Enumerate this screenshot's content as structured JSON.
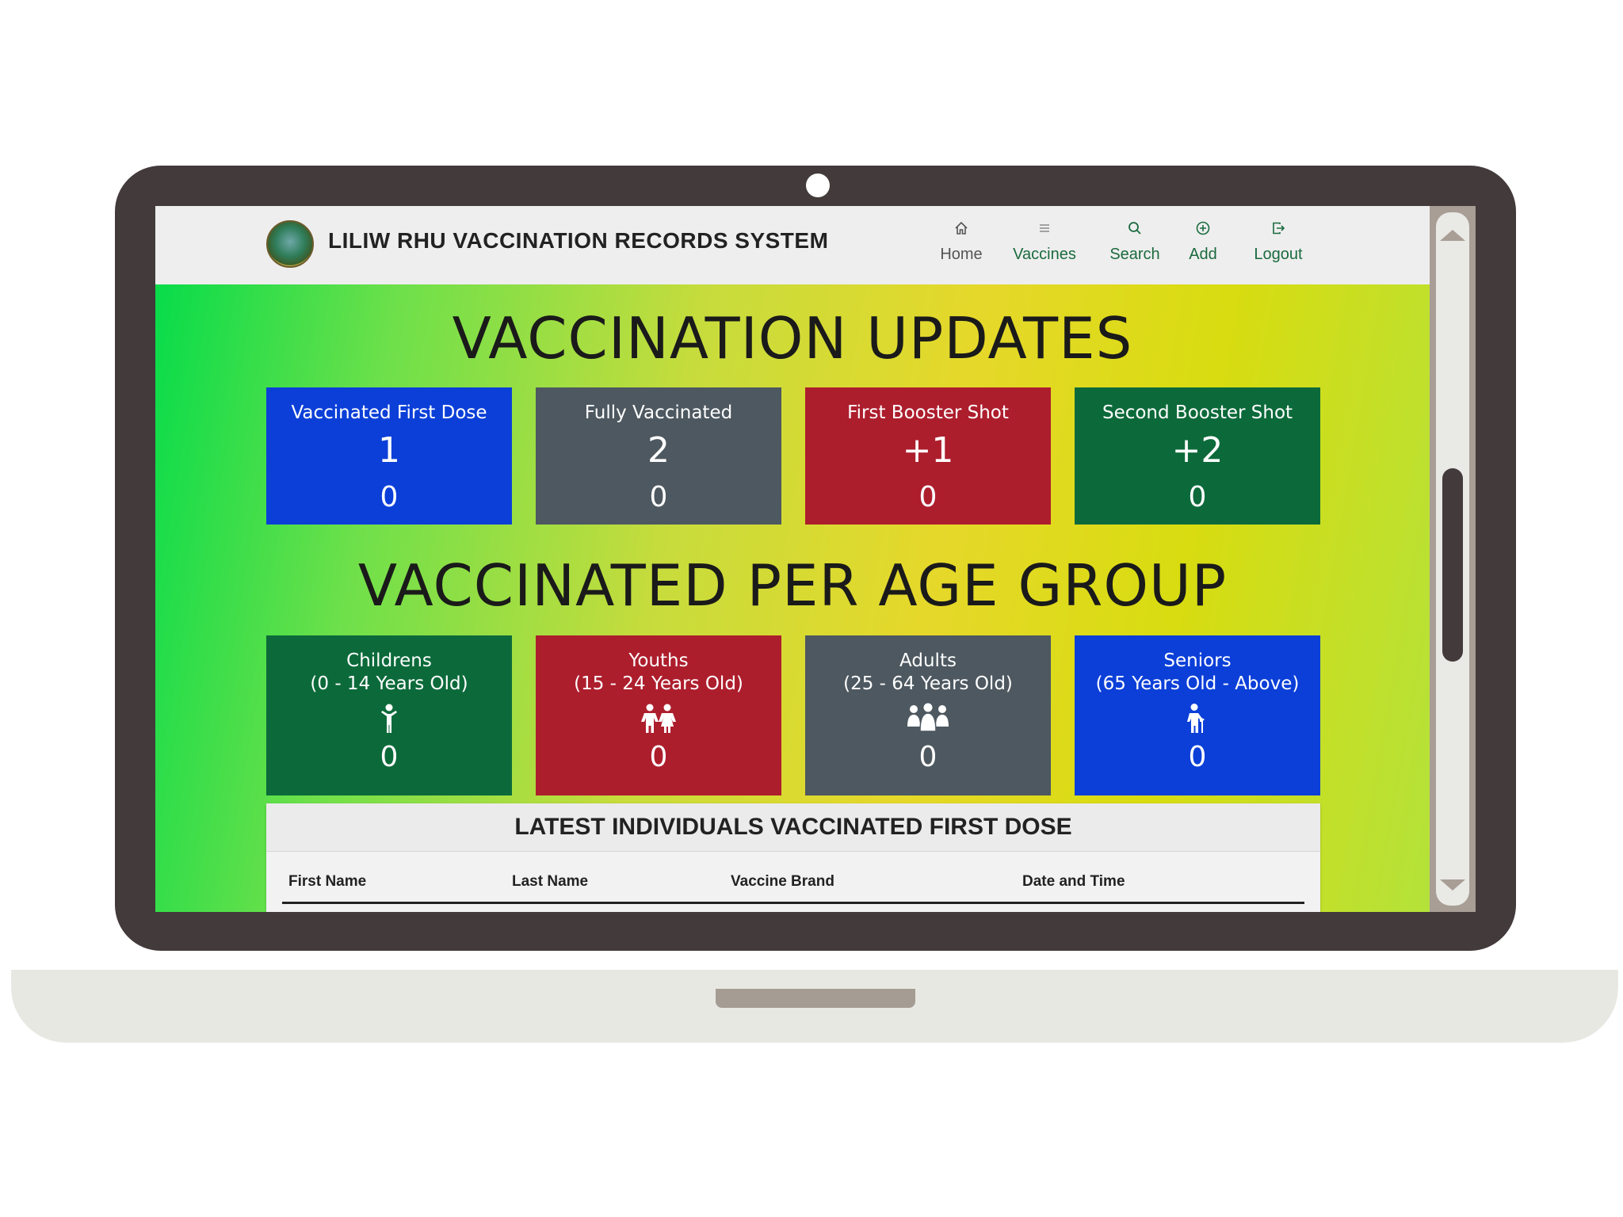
{
  "app": {
    "title": "LILIW RHU VACCINATION RECORDS SYSTEM",
    "logo_icon": "liliw-rhu-seal-icon"
  },
  "nav": {
    "items": [
      {
        "label": "Home",
        "icon": "home-icon"
      },
      {
        "label": "Vaccines",
        "icon": "list-icon"
      },
      {
        "label": "Search",
        "icon": "search-icon"
      },
      {
        "label": "Add",
        "icon": "plus-circle-icon"
      },
      {
        "label": "Logout",
        "icon": "logout-icon"
      }
    ]
  },
  "updates": {
    "heading": "VACCINATION UPDATES",
    "cards": [
      {
        "label": "Vaccinated First Dose",
        "dose": "1",
        "count": "0",
        "color": "#0b3fd8"
      },
      {
        "label": "Fully Vaccinated",
        "dose": "2",
        "count": "0",
        "color": "#4d5860"
      },
      {
        "label": "First Booster Shot",
        "dose": "+1",
        "count": "0",
        "color": "#ad1e2d"
      },
      {
        "label": "Second Booster Shot",
        "dose": "+2",
        "count": "0",
        "color": "#0c6a3a"
      }
    ]
  },
  "age_groups": {
    "heading": "VACCINATED PER AGE GROUP",
    "cards": [
      {
        "label": "Childrens",
        "range": "(0 - 14 Years Old)",
        "icon": "child-icon",
        "count": "0",
        "color": "#0c6a3a"
      },
      {
        "label": "Youths",
        "range": "(15 - 24 Years Old)",
        "icon": "children-icon",
        "count": "0",
        "color": "#ad1e2d"
      },
      {
        "label": "Adults",
        "range": "(25 - 64 Years Old)",
        "icon": "people-group-icon",
        "count": "0",
        "color": "#4d5860"
      },
      {
        "label": "Seniors",
        "range": "(65 Years Old - Above)",
        "icon": "person-cane-icon",
        "count": "0",
        "color": "#0b3fd8"
      }
    ]
  },
  "latest_table": {
    "title": "LATEST INDIVIDUALS VACCINATED FIRST DOSE",
    "columns": [
      "First Name",
      "Last Name",
      "Vaccine Brand",
      "Date and Time"
    ]
  }
}
